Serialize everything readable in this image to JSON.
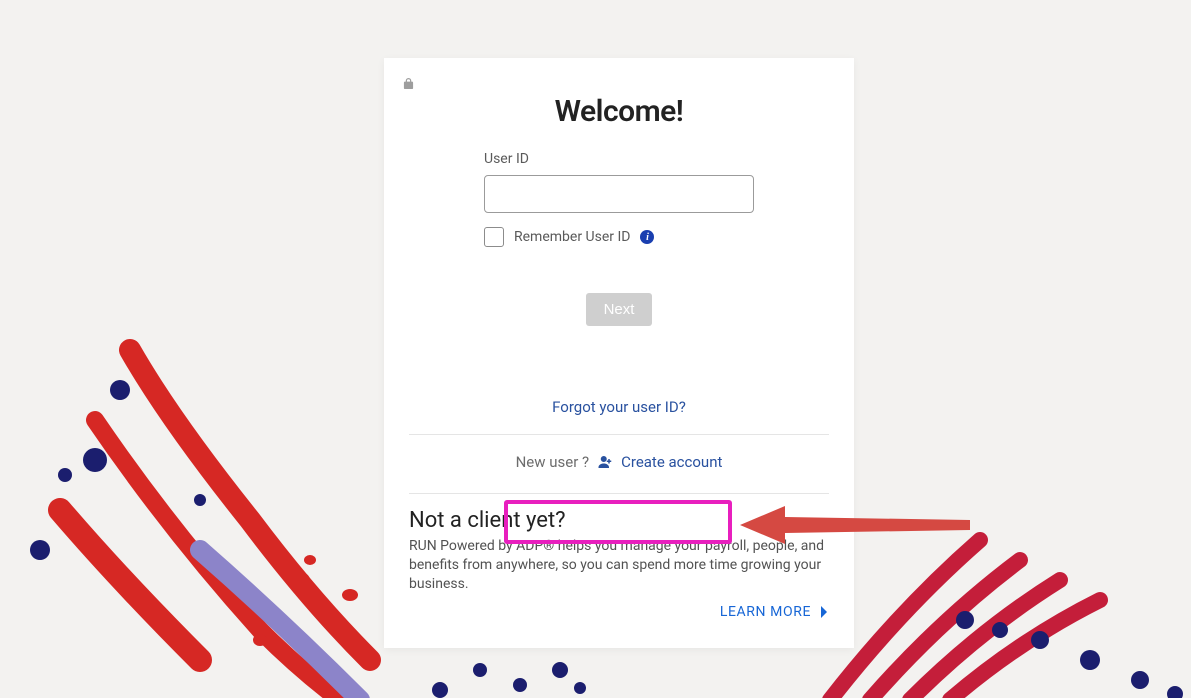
{
  "title": "Welcome!",
  "form": {
    "user_id_label": "User ID",
    "user_id_value": "",
    "remember_label": "Remember User ID",
    "next_label": "Next"
  },
  "links": {
    "forgot": "Forgot your user ID?",
    "new_user_text": "New user ?",
    "create_account": "Create account"
  },
  "promo": {
    "title": "Not a client yet?",
    "body": "RUN Powered by ADP® helps you manage your payroll, people, and benefits from anywhere, so you can spend more time growing your business.",
    "learn_more": "LEARN MORE"
  },
  "colors": {
    "link": "#29519f",
    "learn_more": "#1766d6",
    "highlight": "#e81fbe",
    "arrow": "#d54942",
    "navy": "#1b1e6e",
    "red": "#d62824",
    "purple": "#8c84c9",
    "crimson": "#c41e3a"
  }
}
